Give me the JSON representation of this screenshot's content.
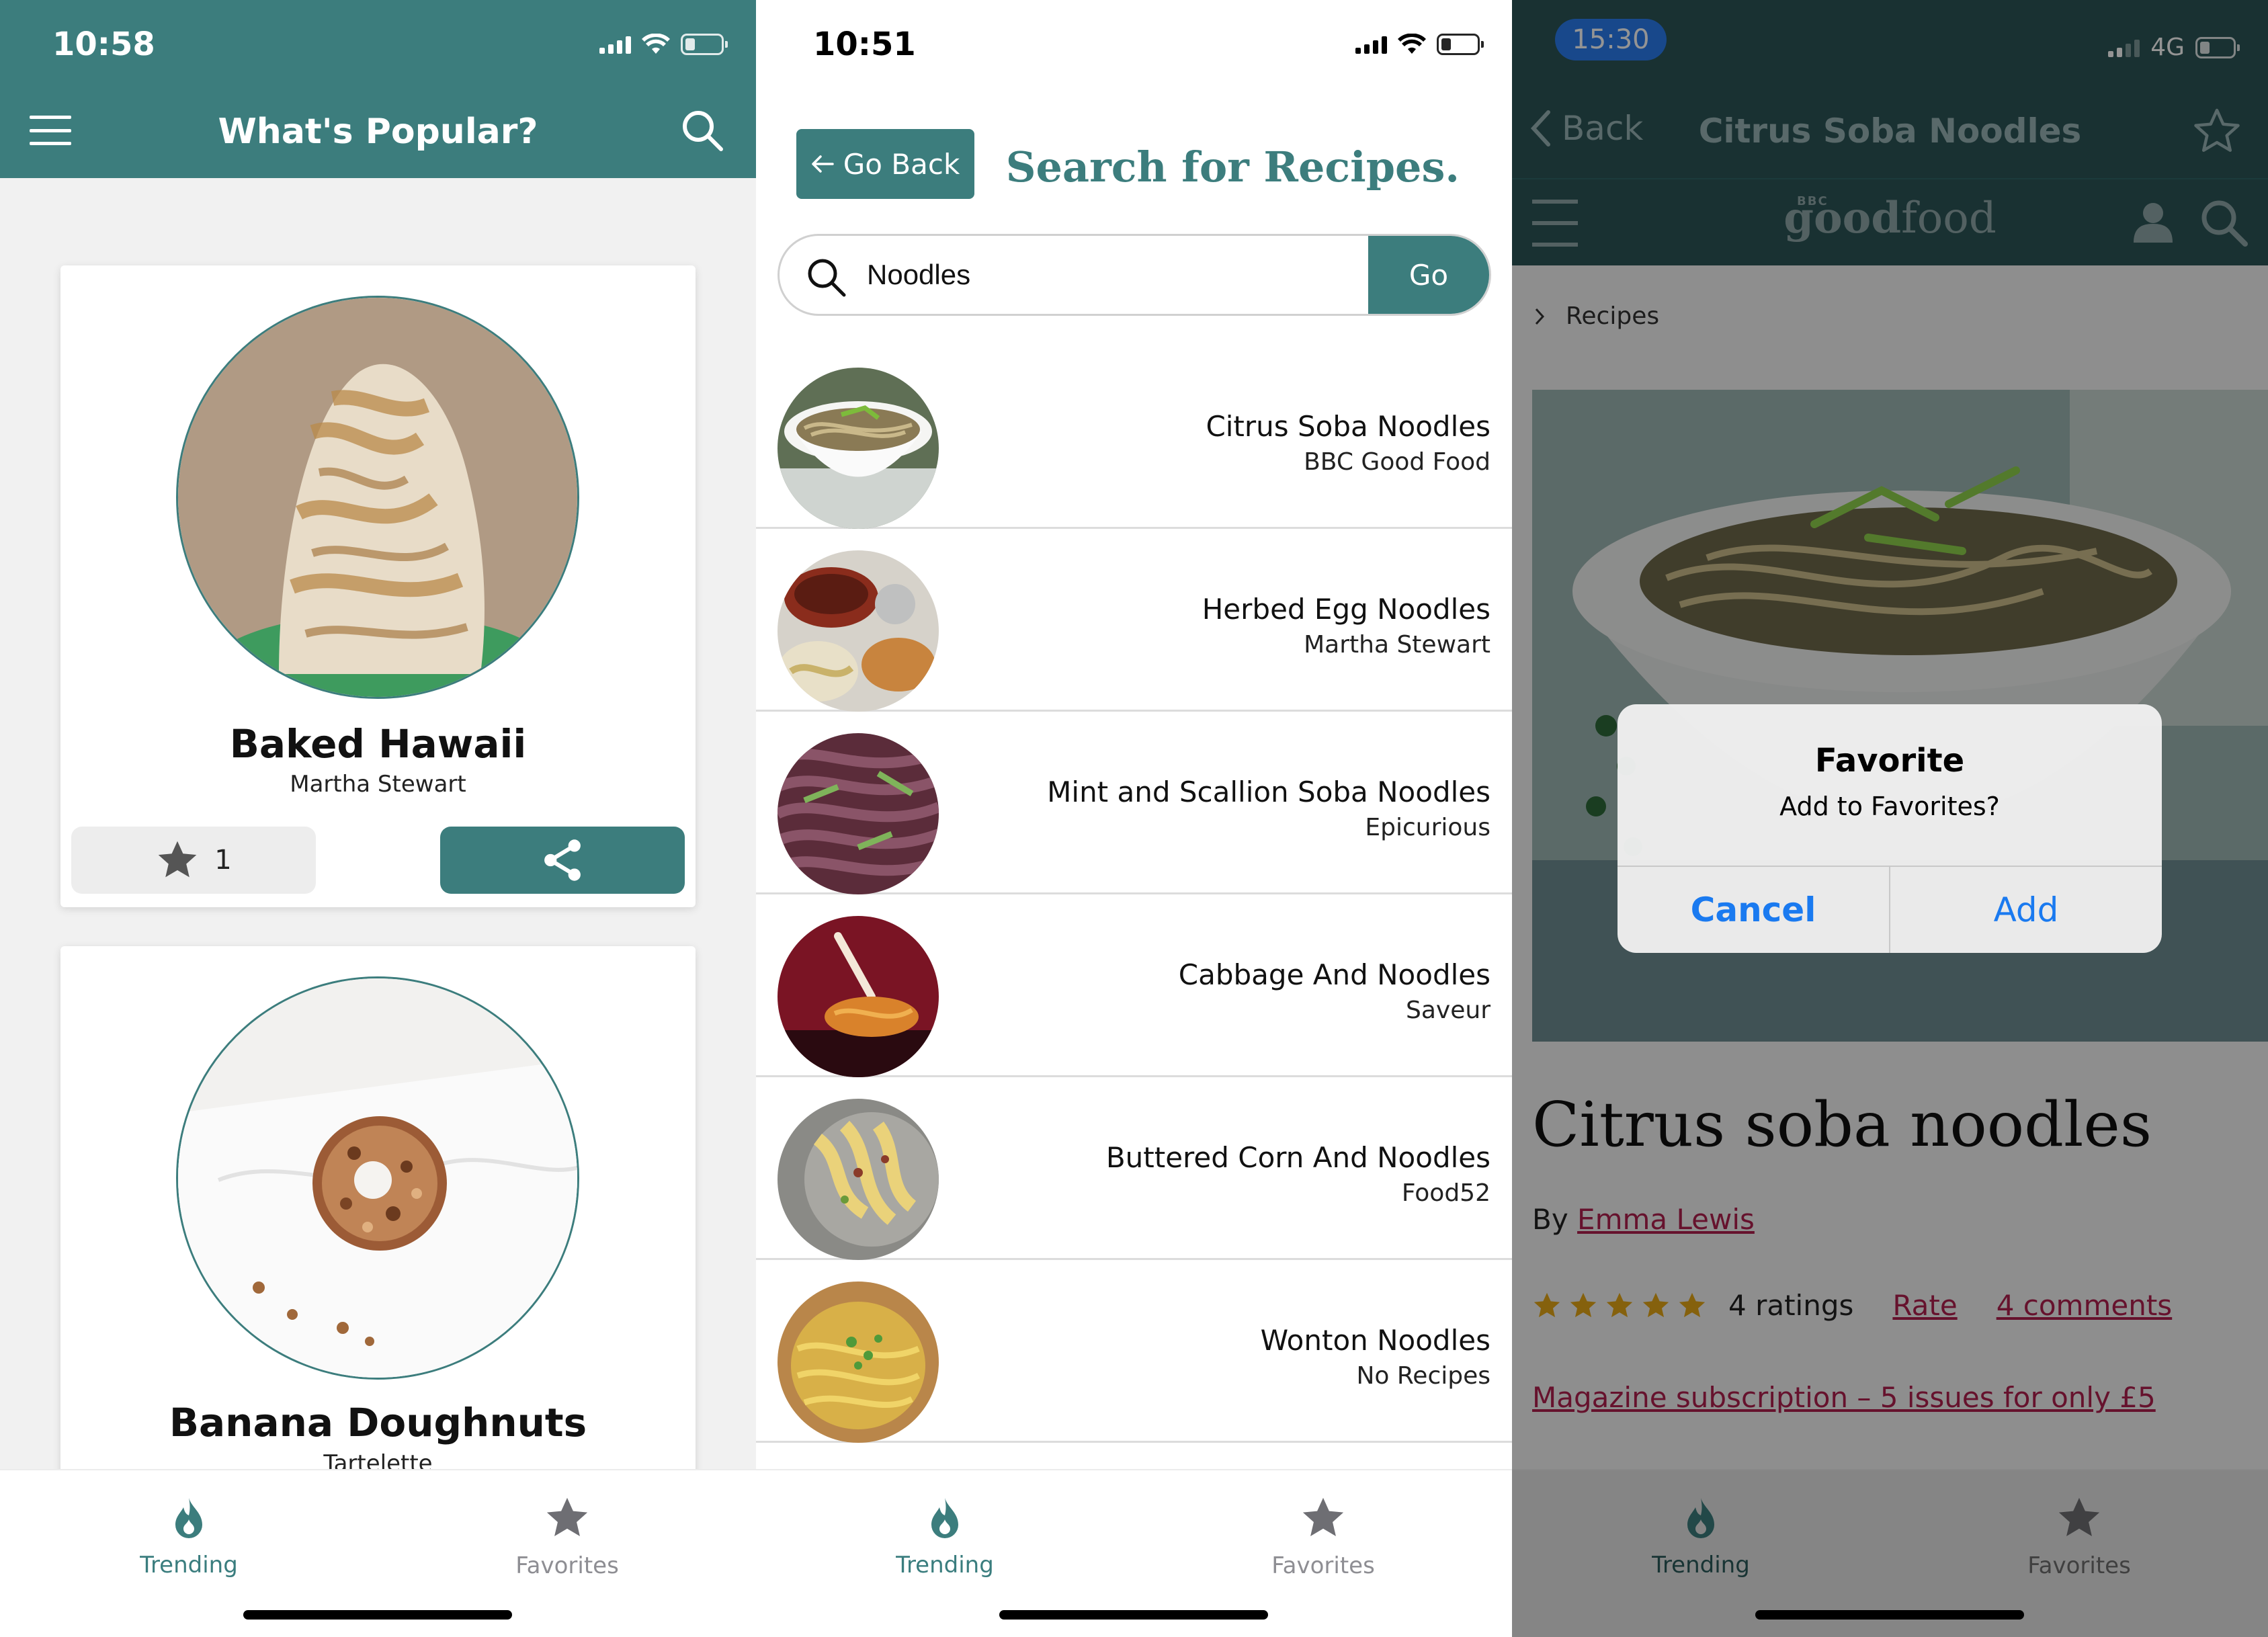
{
  "colors": {
    "teal": "#3c7d7d",
    "link": "#b0204f",
    "ios_blue": "#1a7af0"
  },
  "phone1": {
    "status": {
      "time": "10:58"
    },
    "header": {
      "title": "What's Popular?",
      "menu_icon": "hamburger-menu-icon",
      "search_icon": "search-icon"
    },
    "cards": [
      {
        "title": "Baked Hawaii",
        "source": "Martha Stewart",
        "favorite_count": "1",
        "star_icon": "star-icon",
        "share_icon": "share-icon"
      },
      {
        "title": "Banana Doughnuts",
        "source": "Tartelette"
      }
    ],
    "tabs": [
      {
        "label": "Trending",
        "icon": "flame-icon",
        "active": true
      },
      {
        "label": "Favorites",
        "icon": "star-icon",
        "active": false
      }
    ]
  },
  "phone2": {
    "status": {
      "time": "10:51"
    },
    "go_back_label": "Go Back",
    "heading": "Search for Recipes.",
    "search": {
      "value": "Noodles",
      "go_label": "Go"
    },
    "results": [
      {
        "title": "Citrus Soba Noodles",
        "source": "BBC Good Food"
      },
      {
        "title": "Herbed Egg Noodles",
        "source": "Martha Stewart"
      },
      {
        "title": "Mint and Scallion Soba Noodles",
        "source": "Epicurious"
      },
      {
        "title": "Cabbage And Noodles",
        "source": "Saveur"
      },
      {
        "title": "Buttered Corn And Noodles",
        "source": "Food52"
      },
      {
        "title": "Wonton Noodles",
        "source": "No Recipes"
      }
    ],
    "tabs": [
      {
        "label": "Trending",
        "icon": "flame-icon",
        "active": true
      },
      {
        "label": "Favorites",
        "icon": "star-icon",
        "active": false
      }
    ]
  },
  "phone3": {
    "status": {
      "time": "15:30",
      "network": "4G"
    },
    "nav": {
      "back_label": "Back",
      "title": "Citrus Soba Noodles"
    },
    "site": {
      "bbc_mark": "BBC",
      "logo_good": "good",
      "logo_food": "food"
    },
    "breadcrumb": "Recipes",
    "recipe": {
      "title": "Citrus soba noodles",
      "by_prefix": "By",
      "author": "Emma Lewis",
      "star_rating": 5,
      "ratings_text": "4 ratings",
      "rate_link": "Rate",
      "comments_link": "4 comments",
      "magazine_link": "Magazine subscription – 5 issues for only £5"
    },
    "alert": {
      "title": "Favorite",
      "message": "Add to Favorites?",
      "cancel": "Cancel",
      "add": "Add"
    },
    "tabs": [
      {
        "label": "Trending",
        "icon": "flame-icon",
        "active": true
      },
      {
        "label": "Favorites",
        "icon": "star-icon",
        "active": false
      }
    ]
  }
}
